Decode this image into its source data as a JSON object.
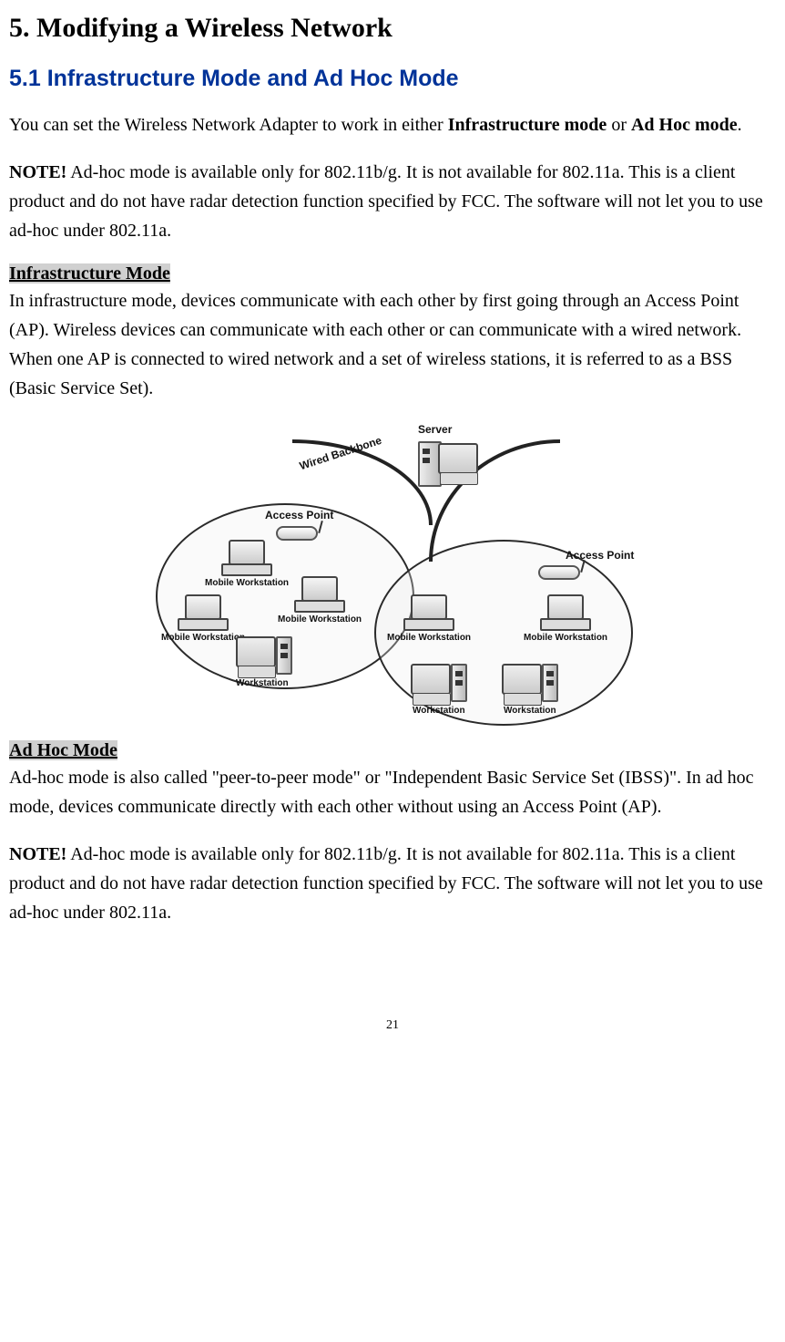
{
  "heading1": "5. Modifying a Wireless Network",
  "heading2": "5.1 Infrastructure Mode and Ad Hoc Mode",
  "intro_pre": "You can set the Wireless Network Adapter to work in either ",
  "intro_bold1": "Infrastructure mode",
  "intro_mid": " or ",
  "intro_bold2": "Ad Hoc mode",
  "intro_post": ".",
  "note1_label": "NOTE!",
  "note1_body": " Ad-hoc mode is available only for 802.11b/g.    It is not available for 802.11a. This is a client product and do not have radar detection function specified by FCC.   The software will not let you to use ad-hoc under 802.11a.",
  "infra_head": "Infrastructure Mode",
  "infra_body": "In infrastructure mode, devices communicate with each other by first going through an Access Point (AP).    Wireless devices can communicate with each other or can communicate with a wired network.    When one AP is connected to wired network and a set of wireless stations, it is referred to as a BSS (Basic Service Set).",
  "adhoc_head": "Ad Hoc Mode",
  "adhoc_body": "Ad-hoc mode is also called \"peer-to-peer mode\" or \"Independent Basic Service Set (IBSS)\".    In ad hoc mode, devices communicate directly with each other without using an Access Point (AP).",
  "note2_label": "NOTE!",
  "note2_body": " Ad-hoc mode is available only for 802.11b/g.    It is not available for 802.11a. This is a client product and do not have radar detection function specified by FCC.   The software will not let you to use ad-hoc under 802.11a.",
  "page_number": "21",
  "diagram": {
    "wired_backbone": "Wired Backbone",
    "server": "Server",
    "access_point": "Access Point",
    "mobile_workstation": "Mobile Workstation",
    "workstation": "Workstation"
  }
}
